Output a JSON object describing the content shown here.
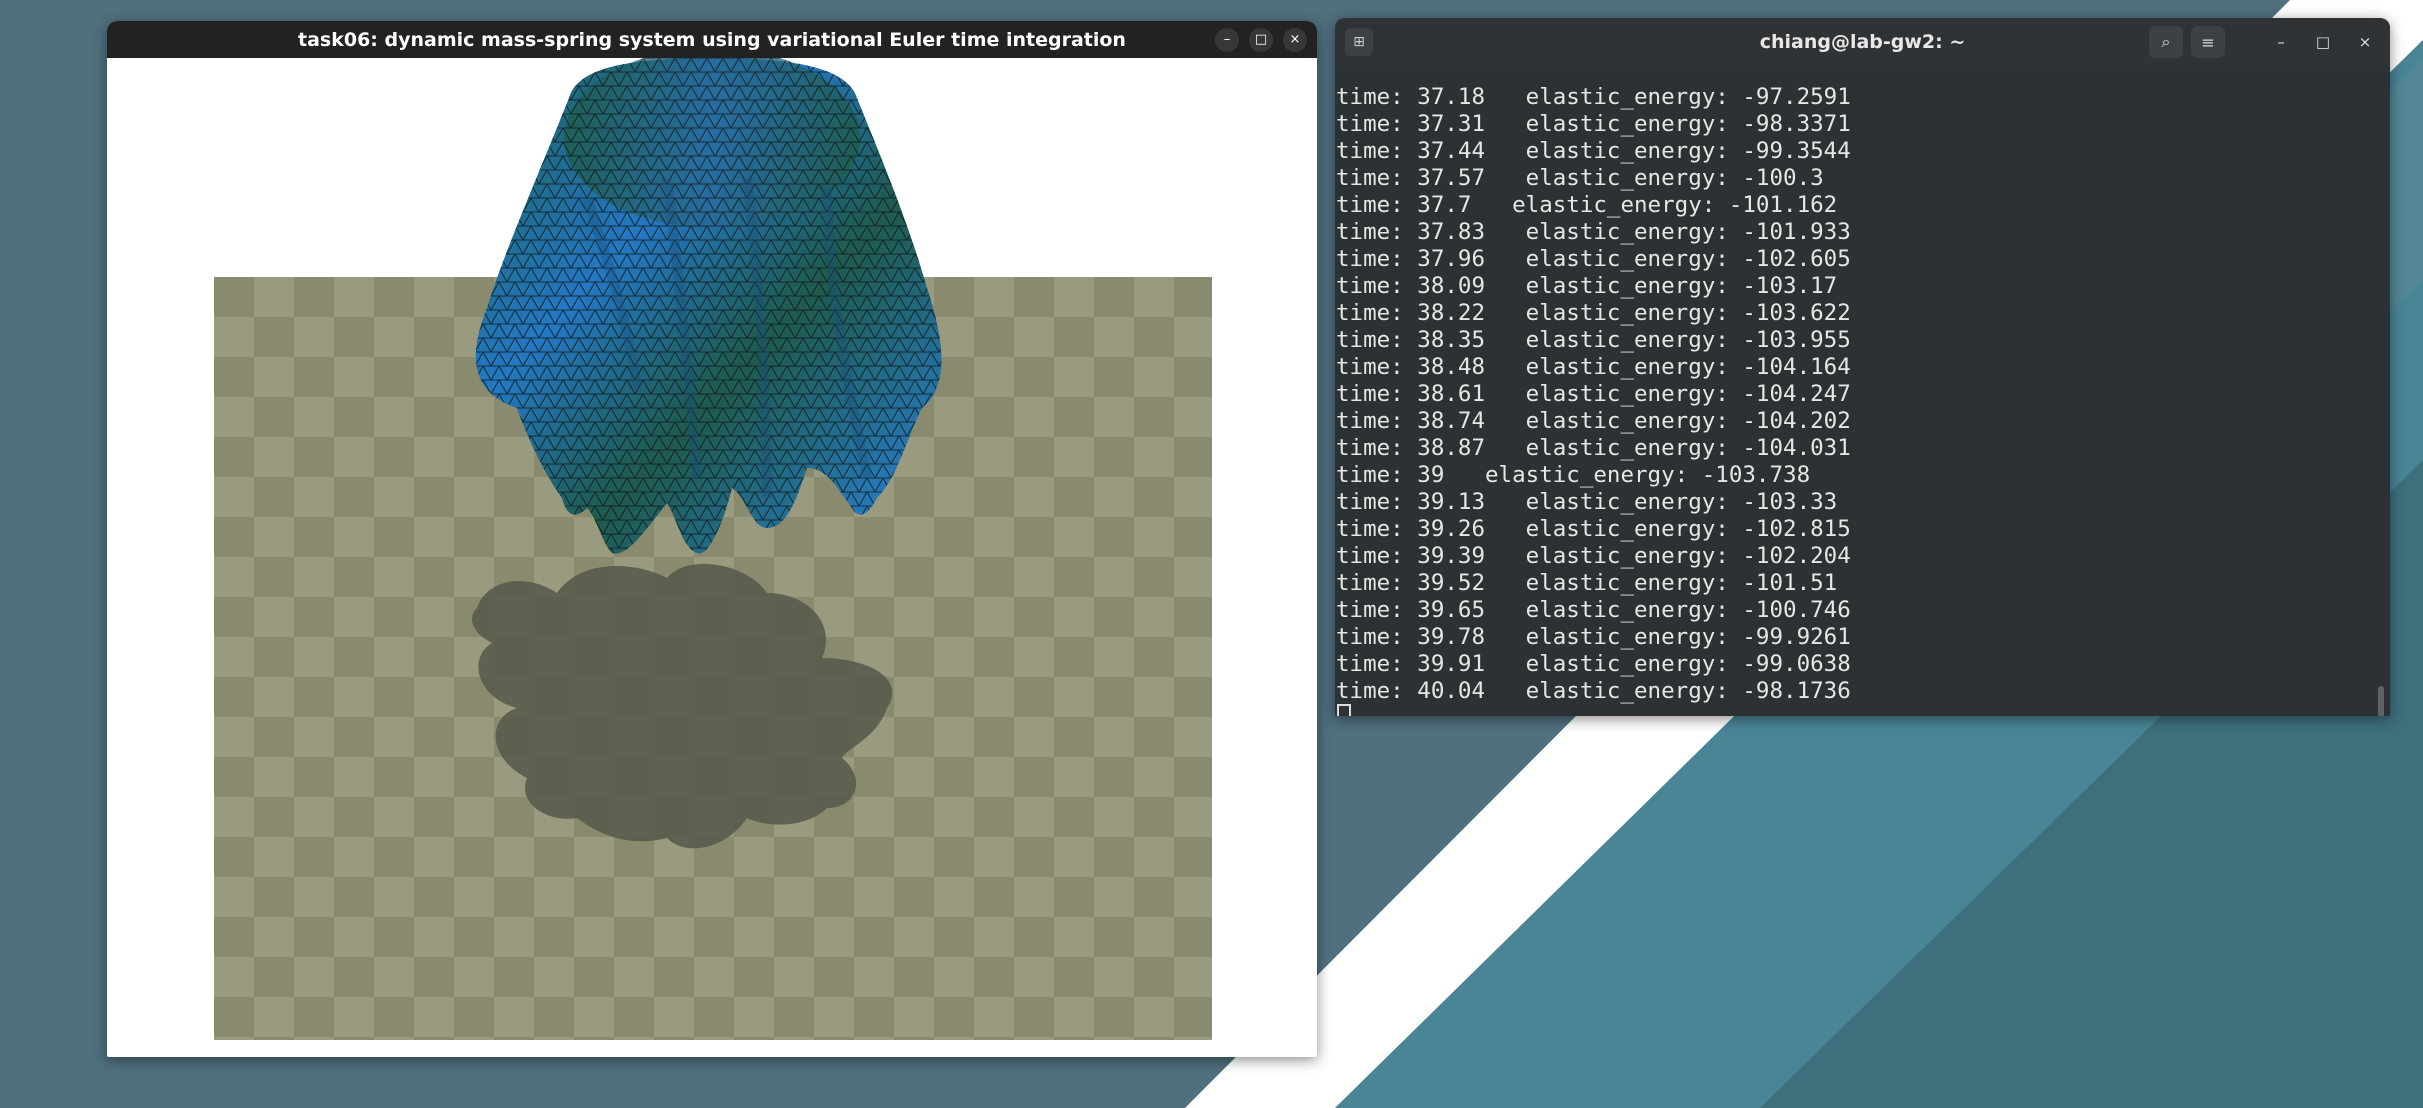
{
  "colors": {
    "desktop_base": "#50707e",
    "desktop_stripe_light": "#6a8e9b",
    "desktop_stripe_white": "#ffffff",
    "desktop_stripe_teal": "#47808d",
    "checker_light": "#9a9a7e",
    "checker_dark": "#8a8a6f",
    "cloth_blue": "#2a86e8",
    "cloth_green": "#1f5a4c",
    "shadow": "#57574a",
    "terminal_bg": "#2c3134",
    "terminal_text": "#e6e6e6"
  },
  "sim_window": {
    "title": "task06: dynamic mass-spring system using variational Euler time integration",
    "controls": {
      "minimize": "–",
      "maximize": "□",
      "close": "×"
    }
  },
  "terminal": {
    "title": "chiang@lab-gw2: ~",
    "new_tab_icon": "⊞",
    "search_icon": "⌕",
    "menu_icon": "≡",
    "controls": {
      "minimize": "–",
      "maximize": "□",
      "close": "×"
    },
    "lines": [
      "time: 37.18   elastic_energy: -97.2591",
      "time: 37.31   elastic_energy: -98.3371",
      "time: 37.44   elastic_energy: -99.3544",
      "time: 37.57   elastic_energy: -100.3",
      "time: 37.7   elastic_energy: -101.162",
      "time: 37.83   elastic_energy: -101.933",
      "time: 37.96   elastic_energy: -102.605",
      "time: 38.09   elastic_energy: -103.17",
      "time: 38.22   elastic_energy: -103.622",
      "time: 38.35   elastic_energy: -103.955",
      "time: 38.48   elastic_energy: -104.164",
      "time: 38.61   elastic_energy: -104.247",
      "time: 38.74   elastic_energy: -104.202",
      "time: 38.87   elastic_energy: -104.031",
      "time: 39   elastic_energy: -103.738",
      "time: 39.13   elastic_energy: -103.33",
      "time: 39.26   elastic_energy: -102.815",
      "time: 39.39   elastic_energy: -102.204",
      "time: 39.52   elastic_energy: -101.51",
      "time: 39.65   elastic_energy: -100.746",
      "time: 39.78   elastic_energy: -99.9261",
      "time: 39.91   elastic_energy: -99.0638",
      "time: 40.04   elastic_energy: -98.1736"
    ]
  }
}
